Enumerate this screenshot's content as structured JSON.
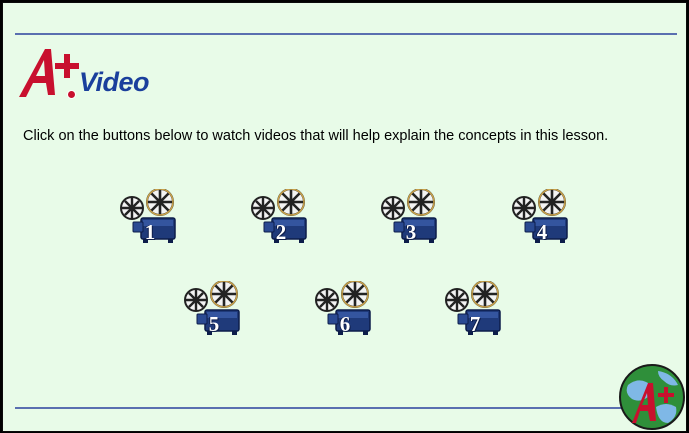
{
  "header": {
    "logo_text": "Video",
    "logo_mark": "A+"
  },
  "instructions": "Click on the buttons below to watch videos that will help explain the concepts in this lesson.",
  "video_buttons": [
    {
      "label": "1",
      "icon": "film-projector-icon"
    },
    {
      "label": "2",
      "icon": "film-projector-icon"
    },
    {
      "label": "3",
      "icon": "film-projector-icon"
    },
    {
      "label": "4",
      "icon": "film-projector-icon"
    },
    {
      "label": "5",
      "icon": "film-projector-icon"
    },
    {
      "label": "6",
      "icon": "film-projector-icon"
    },
    {
      "label": "7",
      "icon": "film-projector-icon"
    }
  ],
  "footer": {
    "globe_icon": "globe-logo-icon"
  },
  "colors": {
    "background": "#e8fbe8",
    "rule": "#5a6fb0",
    "brand_red": "#c8102e",
    "brand_blue": "#1a3f9c",
    "projector_blue": "#1f3a7a"
  }
}
